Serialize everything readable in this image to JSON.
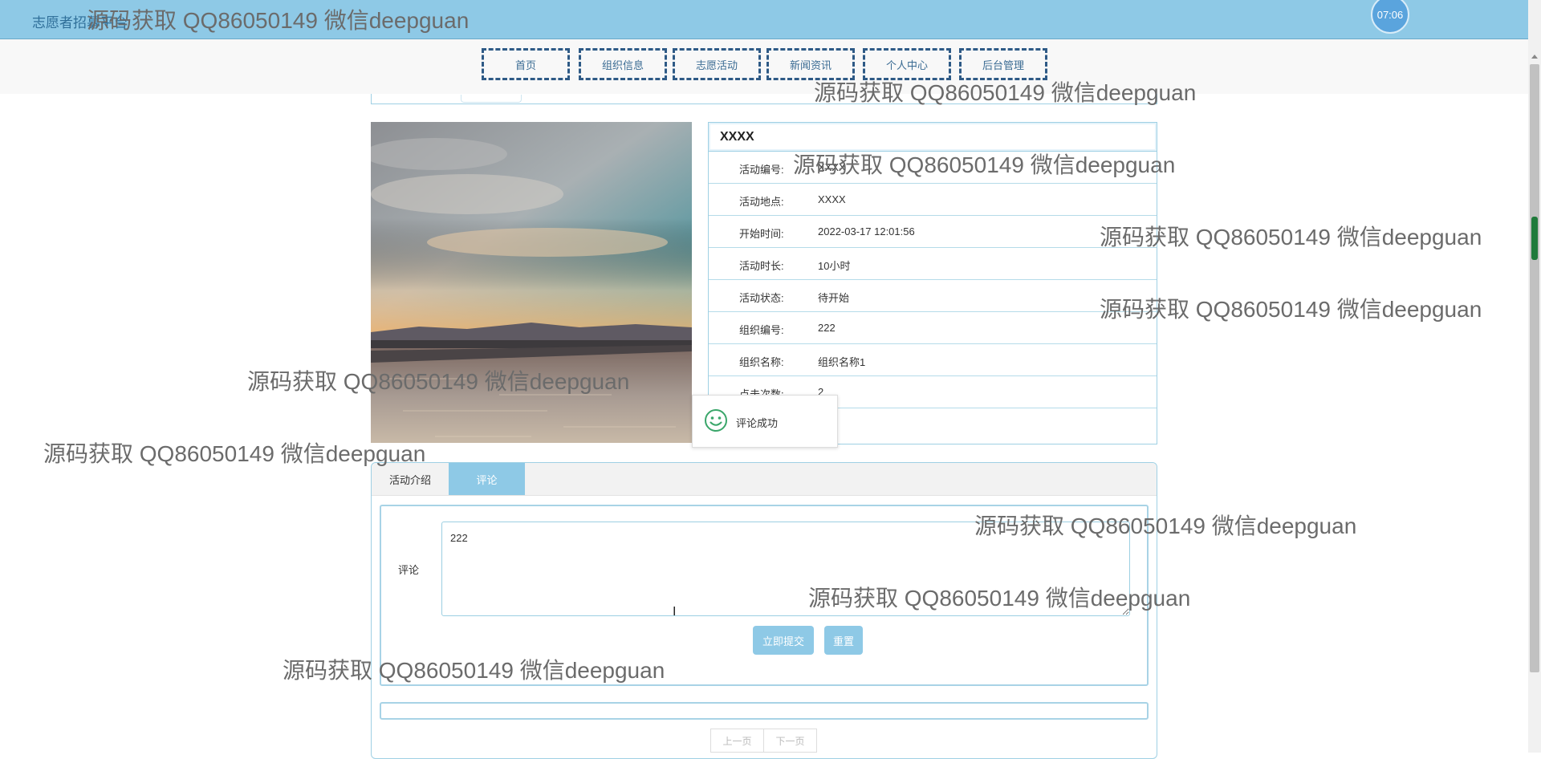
{
  "header": {
    "site_title": "志愿者招募平台",
    "clock": "07:06"
  },
  "nav": [
    "首页",
    "组织信息",
    "志愿活动",
    "新闻资讯",
    "个人中心",
    "后台管理"
  ],
  "activity": {
    "title": "XXXX",
    "fields": [
      {
        "label": "活动编号:",
        "value": "XXXX"
      },
      {
        "label": "活动地点:",
        "value": "XXXX"
      },
      {
        "label": "开始时间:",
        "value": "2022-03-17 12:01:56"
      },
      {
        "label": "活动时长:",
        "value": "10小时"
      },
      {
        "label": "活动状态:",
        "value": "待开始"
      },
      {
        "label": "组织编号:",
        "value": "222"
      },
      {
        "label": "组织名称:",
        "value": "组织名称1"
      },
      {
        "label": "点击次数:",
        "value": "2"
      }
    ]
  },
  "toast": {
    "message": "评论成功"
  },
  "tabs": {
    "intro": "活动介绍",
    "comment": "评论"
  },
  "comment_form": {
    "label": "评论",
    "value": "222",
    "submit": "立即提交",
    "reset": "重置"
  },
  "pager": {
    "prev": "上一页",
    "next": "下一页"
  },
  "watermark": "源码获取 QQ86050149 微信deepguan"
}
